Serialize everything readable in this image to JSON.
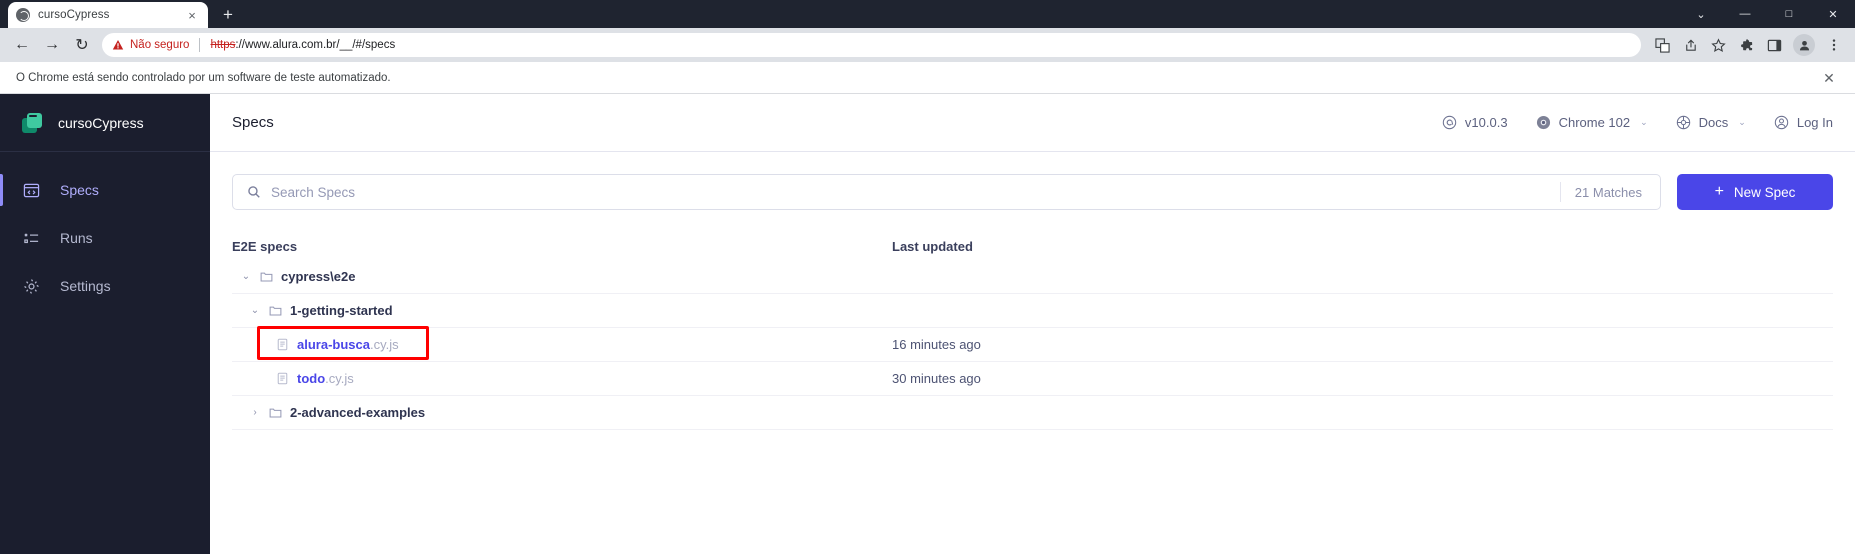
{
  "browser": {
    "tab": {
      "title": "cursoCypress",
      "favicon": "globe-icon",
      "close": "×"
    },
    "new_tab": "+",
    "window_controls": {
      "minimize": "—",
      "maximize": "□",
      "close": "✕",
      "chevron": "⌄"
    },
    "nav": {
      "back": "←",
      "forward": "→",
      "reload": "↻"
    },
    "omnibox": {
      "security_label": "Não seguro",
      "warning_icon": "warning-triangle-icon",
      "url_protocol": "https",
      "url_rest": "://www.alura.com.br/__/#/specs"
    },
    "toolbar_icons": [
      "translate-icon",
      "share-icon",
      "bookmark-star-icon",
      "extensions-puzzle-icon",
      "side-panel-icon",
      "profile-avatar-icon",
      "three-dot-menu-icon"
    ],
    "infobar": {
      "message": "O Chrome está sendo controlado por um software de teste automatizado.",
      "close": "✕"
    }
  },
  "sidebar": {
    "project_name": "cursoCypress",
    "logo": "cypress-logo-icon",
    "items": [
      {
        "label": "Specs",
        "icon": "specs-icon",
        "active": true
      },
      {
        "label": "Runs",
        "icon": "runs-icon",
        "active": false
      },
      {
        "label": "Settings",
        "icon": "gear-icon",
        "active": false
      }
    ]
  },
  "header": {
    "title": "Specs",
    "right_items": [
      {
        "label": "v10.0.3",
        "icon": "cypress-badge-icon",
        "chevron": ""
      },
      {
        "label": "Chrome 102",
        "icon": "chrome-icon",
        "chevron": "⌄"
      },
      {
        "label": "Docs",
        "icon": "docs-globe-icon",
        "chevron": "⌄"
      },
      {
        "label": "Log In",
        "icon": "user-circle-icon",
        "chevron": ""
      }
    ]
  },
  "search": {
    "placeholder": "Search Specs",
    "value": "",
    "icon": "search-icon",
    "matches": "21 Matches"
  },
  "new_spec_button": {
    "label": "New Spec",
    "plus": "+",
    "color": "#4a46e8"
  },
  "table": {
    "columns": {
      "spec": "E2E specs",
      "last_updated": "Last updated"
    },
    "rows": [
      {
        "type": "folder",
        "name": "cypress\\e2e",
        "indent": 1,
        "twisty": "⌄",
        "expanded": true,
        "last_updated": "",
        "highlighted": false
      },
      {
        "type": "folder",
        "name": "1-getting-started",
        "indent": 2,
        "twisty": "⌄",
        "expanded": true,
        "last_updated": "",
        "highlighted": false
      },
      {
        "type": "file",
        "name": "alura-busca",
        "ext": ".cy.js",
        "indent": 3,
        "twisty": "",
        "last_updated": "16 minutes ago",
        "highlighted": true
      },
      {
        "type": "file",
        "name": "todo",
        "ext": ".cy.js",
        "indent": 3,
        "twisty": "",
        "last_updated": "30 minutes ago",
        "highlighted": false
      },
      {
        "type": "folder",
        "name": "2-advanced-examples",
        "indent": 2,
        "twisty": "›",
        "expanded": false,
        "last_updated": "",
        "highlighted": false
      }
    ]
  },
  "annotation": {
    "color": "#ff0000",
    "target": "alura-busca.cy.js"
  }
}
